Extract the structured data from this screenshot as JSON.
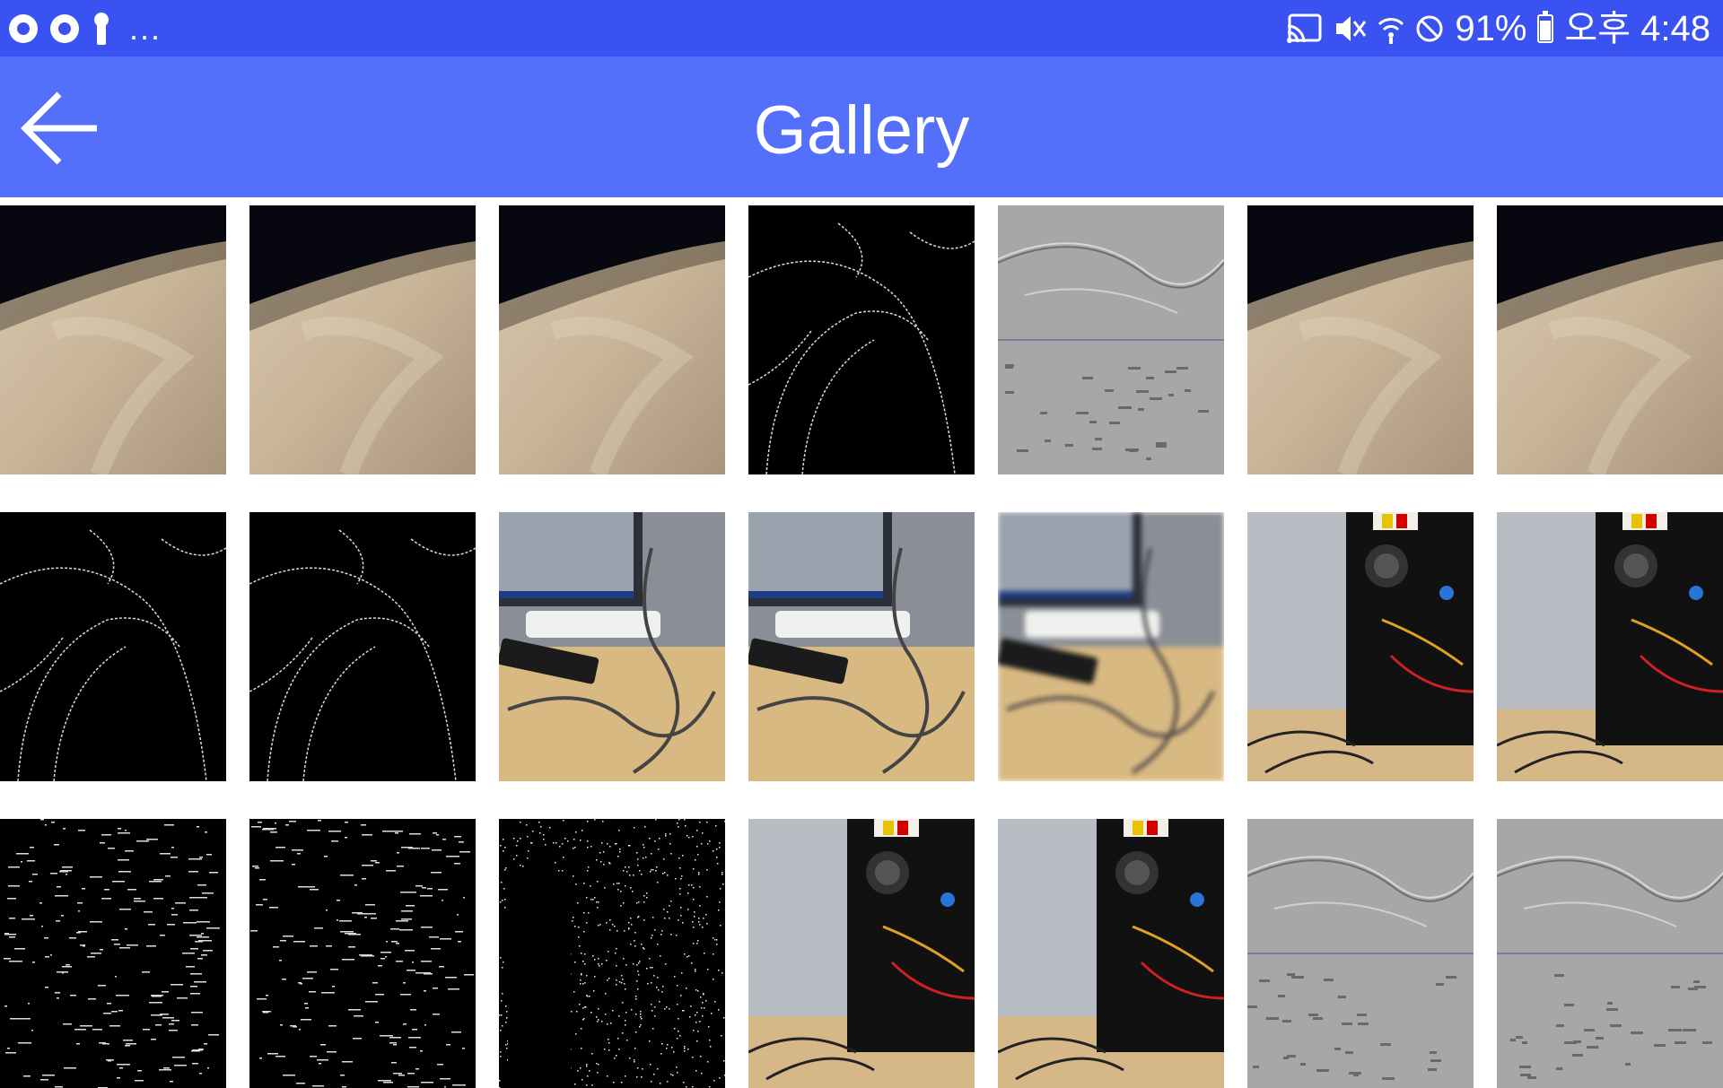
{
  "status_bar": {
    "left_icons": [
      "aperture-icon",
      "aperture-icon",
      "keyhole-icon"
    ],
    "overflow": "...",
    "battery": "91%",
    "time": "오후 4:48",
    "right_icons": [
      "cast-icon",
      "vibrate-mute-icon",
      "wifi-icon",
      "do-not-disturb-icon",
      "battery-charging-icon"
    ]
  },
  "app_bar": {
    "back_icon": "arrow-left-icon",
    "title": "Gallery"
  },
  "colors": {
    "status_bar": "#3b52f2",
    "app_bar": "#5470fb",
    "background": "#ffffff"
  },
  "gallery": {
    "rows": [
      [
        "wood",
        "wood",
        "wood",
        "edges",
        "emboss",
        "wood",
        "wood"
      ],
      [
        "edges",
        "edges",
        "desk",
        "desk",
        "desk-blur",
        "pc",
        "pc"
      ],
      [
        "noise-text",
        "noise-text",
        "noise-dots",
        "pc",
        "pc",
        "emboss",
        "emboss"
      ]
    ],
    "descriptions": {
      "wood": "wood surface photo",
      "edges": "edge detection image",
      "emboss": "embossed grayscale image",
      "desk": "desk with monitor and cables",
      "desk-blur": "blurred desk with monitor",
      "pc": "open computer case",
      "noise-text": "binarized screen image",
      "noise-dots": "noisy binarized image"
    }
  }
}
